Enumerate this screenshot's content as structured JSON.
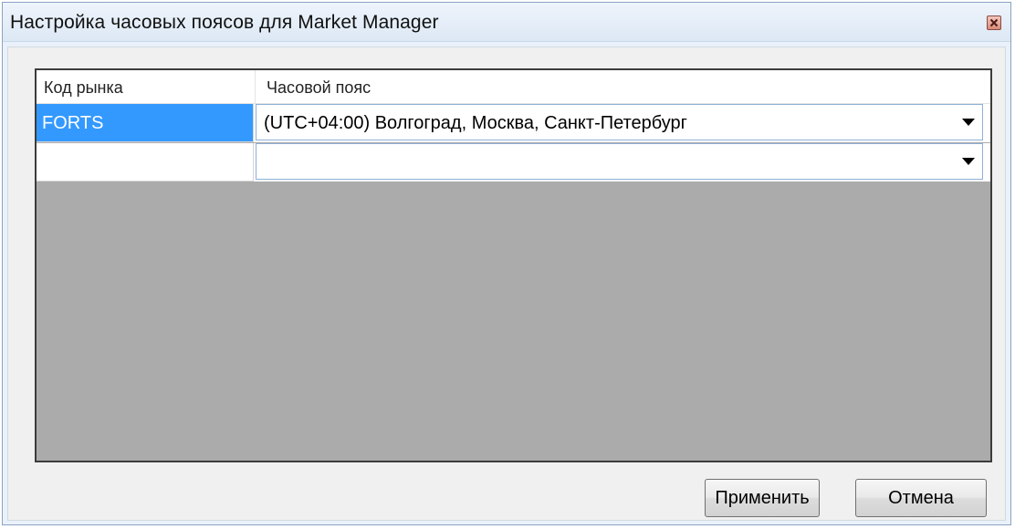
{
  "window": {
    "title": "Настройка часовых поясов для Market Manager"
  },
  "grid": {
    "columns": [
      "Код рынка",
      "Часовой пояс"
    ],
    "rows": [
      {
        "market_code": "FORTS",
        "timezone": "(UTC+04:00) Волгоград, Москва, Санкт-Петербург",
        "selected": true
      },
      {
        "market_code": "",
        "timezone": "",
        "selected": false
      }
    ]
  },
  "buttons": {
    "apply": "Применить",
    "cancel": "Отмена"
  },
  "icons": {
    "close": "close-icon",
    "dropdown": "chevron-down-icon"
  },
  "colors": {
    "selection": "#3399ff",
    "grid_background": "#ababab",
    "title_bar": "#dde8f5"
  }
}
